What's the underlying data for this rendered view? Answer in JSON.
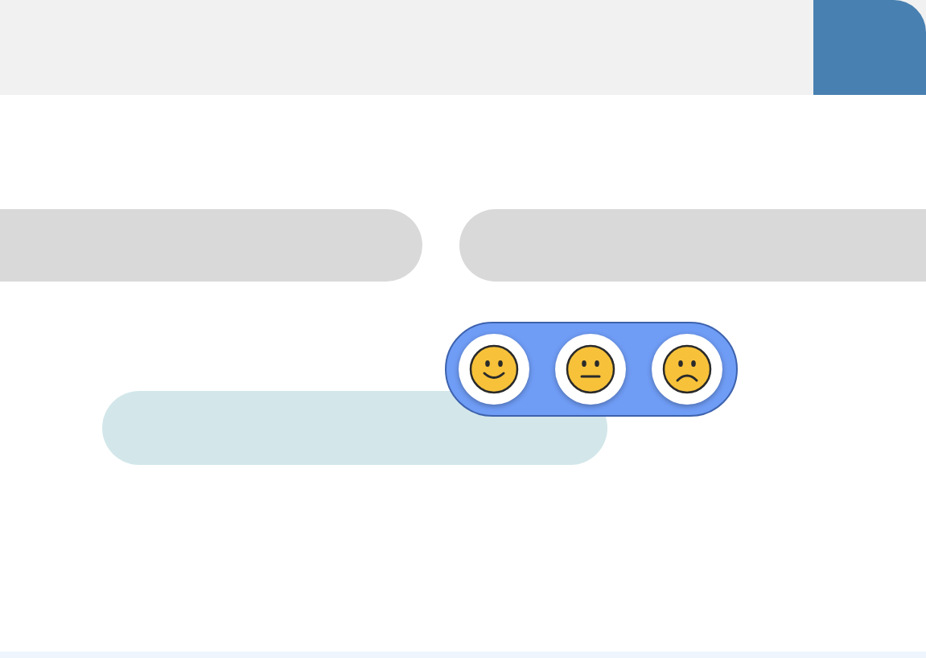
{
  "feedback_options": [
    {
      "kind": "happy"
    },
    {
      "kind": "neutral"
    },
    {
      "kind": "sad"
    }
  ]
}
